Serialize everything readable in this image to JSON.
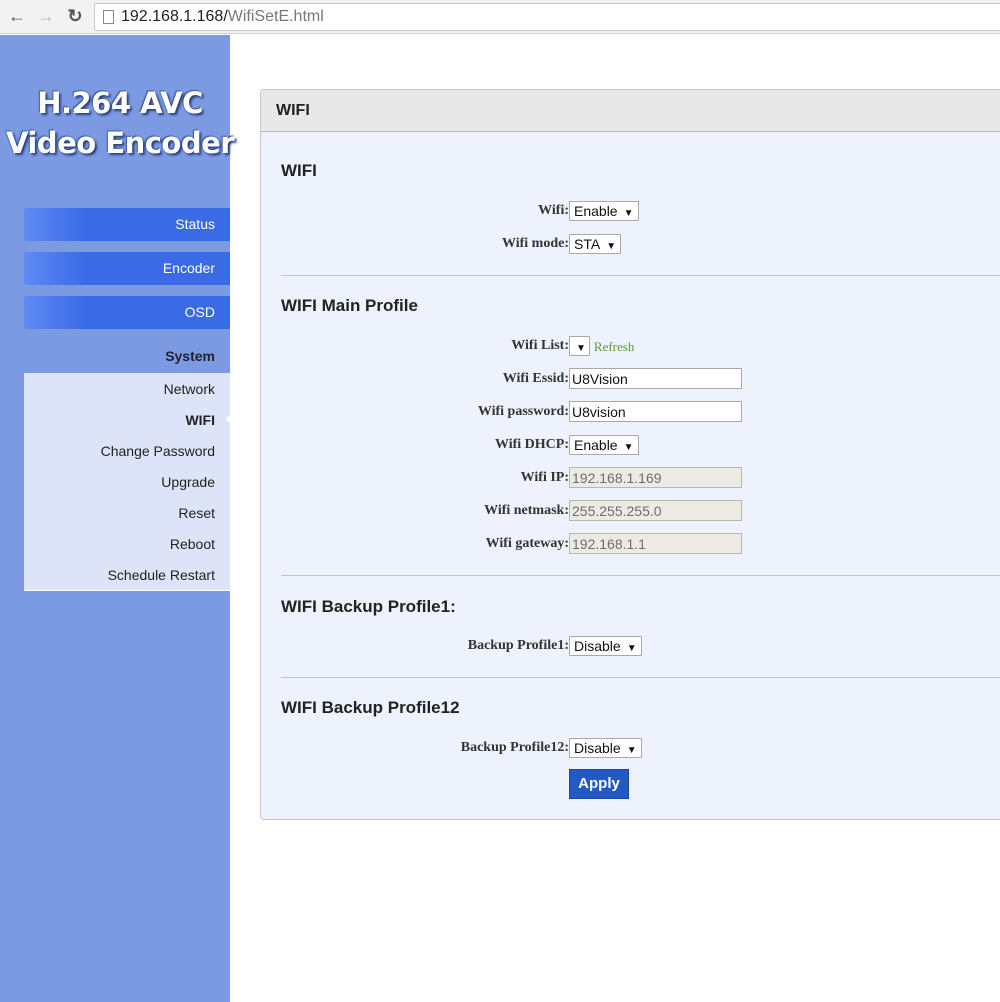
{
  "browser": {
    "url_host": "192.168.1.168/",
    "url_path": "WifiSetE.html",
    "back_icon": "back-arrow-icon",
    "forward_icon": "forward-arrow-icon",
    "reload_icon": "reload-icon"
  },
  "sidebar": {
    "logo_line1": "H.264 AVC",
    "logo_line2": "Video Encoder",
    "menu": [
      {
        "label": "Status"
      },
      {
        "label": "Encoder"
      },
      {
        "label": "OSD"
      }
    ],
    "system_label": "System",
    "submenu": [
      {
        "label": "Network"
      },
      {
        "label": "WIFI",
        "active": true
      },
      {
        "label": "Change Password"
      },
      {
        "label": "Upgrade"
      },
      {
        "label": "Reset"
      },
      {
        "label": "Reboot"
      },
      {
        "label": "Schedule Restart"
      }
    ]
  },
  "panel": {
    "title": "WIFI",
    "sections": {
      "wifi": {
        "title": "WIFI",
        "wifi_label": "Wifi:",
        "wifi_value": "Enable",
        "mode_label": "Wifi mode:",
        "mode_value": "STA"
      },
      "main": {
        "title": "WIFI Main Profile",
        "list_label": "Wifi List:",
        "list_value": "",
        "refresh": "Refresh",
        "essid_label": "Wifi Essid:",
        "essid_value": "U8Vision",
        "password_label": "Wifi password:",
        "password_value": "U8vision",
        "dhcp_label": "Wifi DHCP:",
        "dhcp_value": "Enable",
        "ip_label": "Wifi IP:",
        "ip_value": "192.168.1.169",
        "netmask_label": "Wifi netmask:",
        "netmask_value": "255.255.255.0",
        "gateway_label": "Wifi gateway:",
        "gateway_value": "192.168.1.1"
      },
      "backup1": {
        "title": "WIFI Backup Profile1:",
        "label": "Backup Profile1:",
        "value": "Disable"
      },
      "backup2": {
        "title": "WIFI Backup Profile12",
        "label": "Backup Profile12:",
        "value": "Disable"
      }
    },
    "apply_label": "Apply"
  }
}
